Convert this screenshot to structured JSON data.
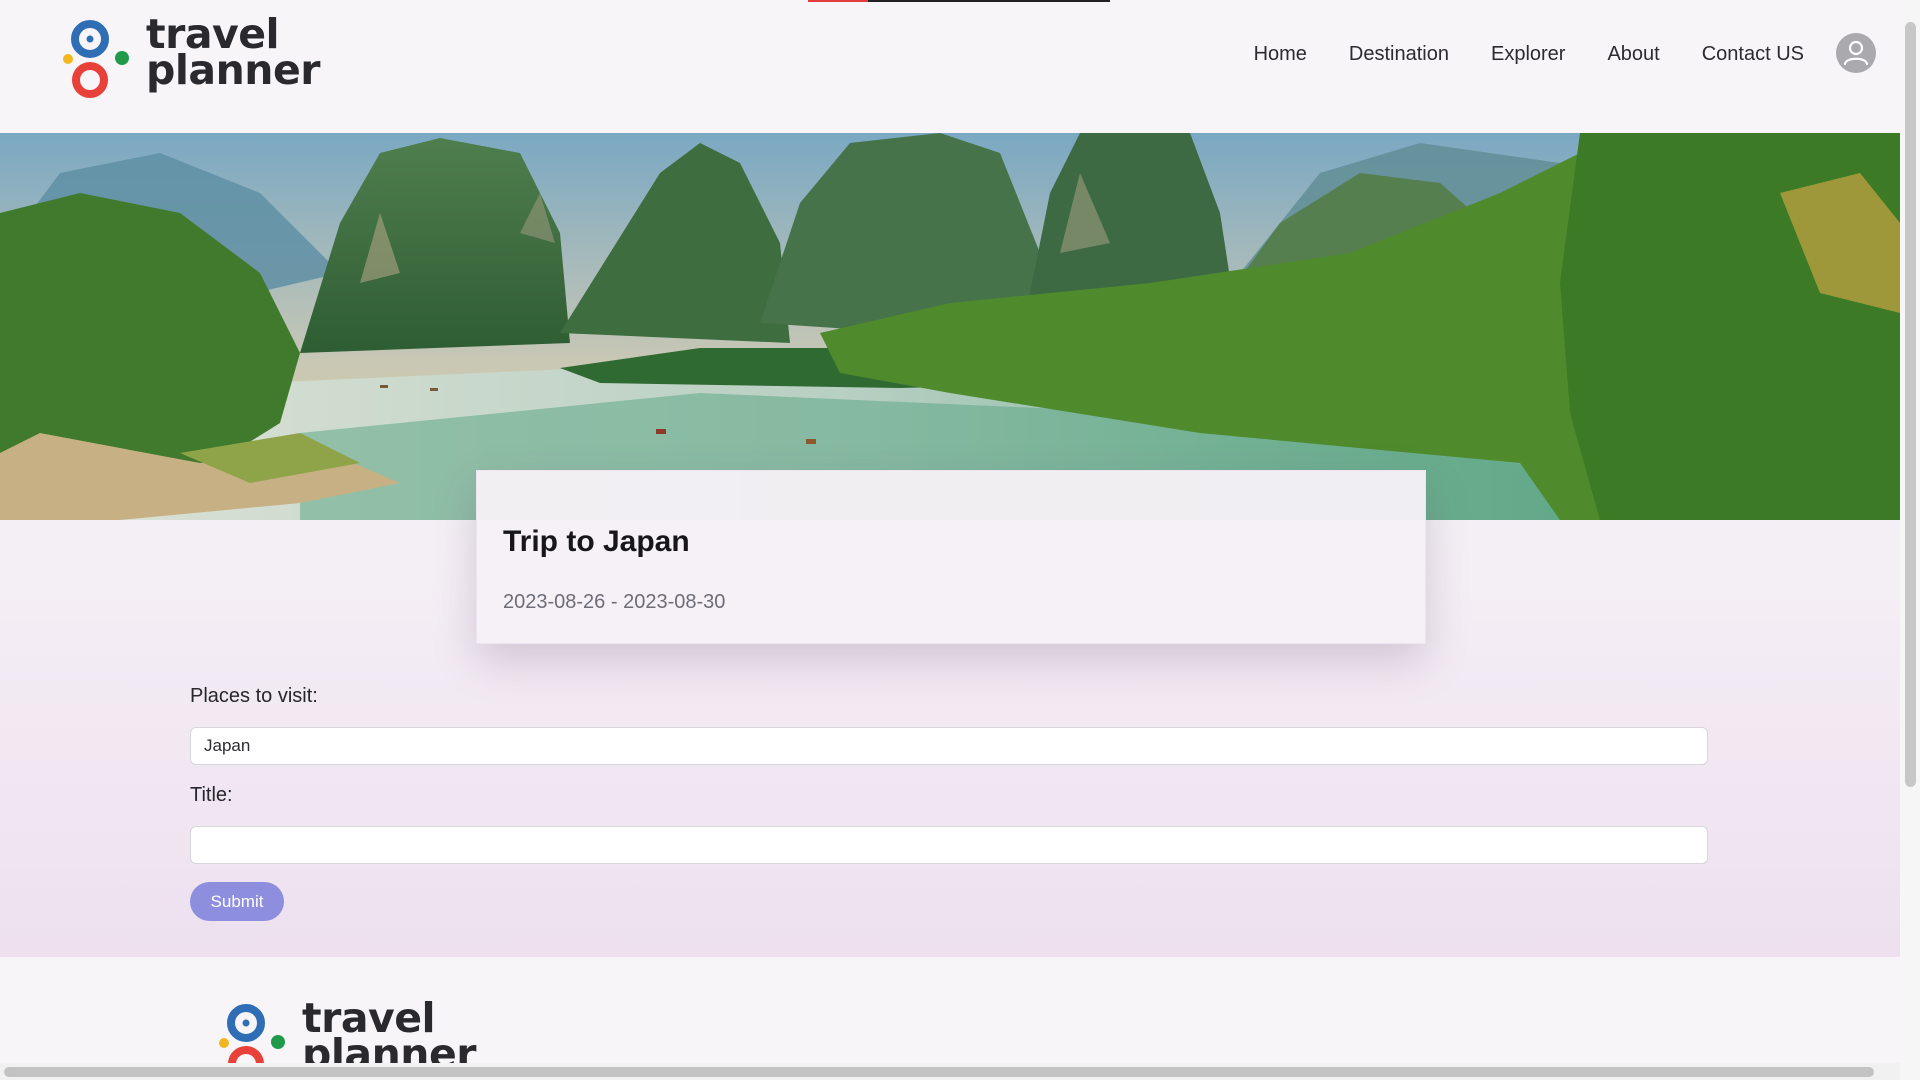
{
  "brand": {
    "line1": "travel",
    "line2": "planner",
    "colors": {
      "blue": "#2f6db5",
      "red": "#e8413a",
      "green": "#1e9a4a",
      "yellow": "#f2b61f"
    }
  },
  "nav": {
    "items": [
      {
        "label": "Home"
      },
      {
        "label": "Destination"
      },
      {
        "label": "Explorer"
      },
      {
        "label": "About"
      },
      {
        "label": "Contact US"
      }
    ],
    "avatar_icon": "user-icon"
  },
  "trip": {
    "title": "Trip to Japan",
    "dates": "2023-08-26 - 2023-08-30"
  },
  "form": {
    "places_label": "Places to visit:",
    "places_value": "Japan",
    "title_label": "Title:",
    "title_value": "",
    "submit_label": "Submit",
    "submit_color": "#8d8fde"
  },
  "footer": {
    "line1": "travel",
    "line2": "planner"
  }
}
